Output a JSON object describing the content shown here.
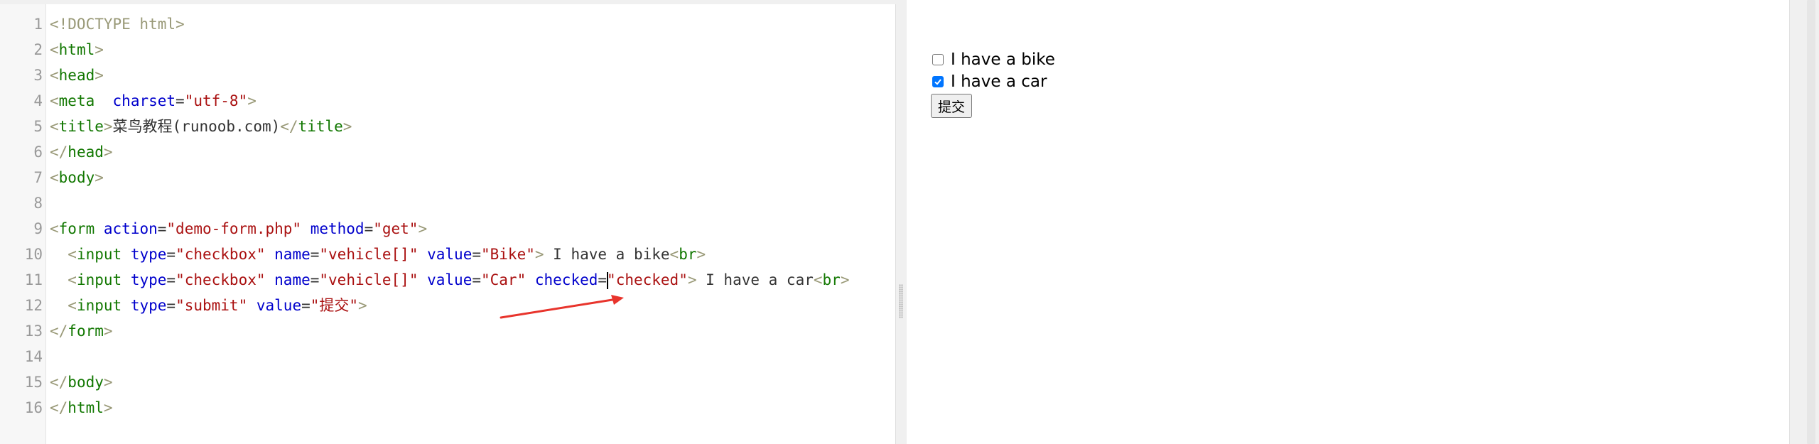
{
  "editor": {
    "line_numbers": [
      "1",
      "2",
      "3",
      "4",
      "5",
      "6",
      "7",
      "8",
      "9",
      "10",
      "11",
      "12",
      "13",
      "14",
      "15",
      "16"
    ],
    "lines": [
      [
        {
          "t": "tok-bracket",
          "v": "<!DOCTYPE html>"
        }
      ],
      [
        {
          "t": "tok-bracket",
          "v": "<"
        },
        {
          "t": "tok-tag",
          "v": "html"
        },
        {
          "t": "tok-bracket",
          "v": ">"
        }
      ],
      [
        {
          "t": "tok-bracket",
          "v": "<"
        },
        {
          "t": "tok-tag",
          "v": "head"
        },
        {
          "t": "tok-bracket",
          "v": ">"
        }
      ],
      [
        {
          "t": "tok-bracket",
          "v": "<"
        },
        {
          "t": "tok-tag",
          "v": "meta"
        },
        {
          "t": "tok-text",
          "v": "  "
        },
        {
          "t": "tok-attr",
          "v": "charset"
        },
        {
          "t": "tok-text",
          "v": "="
        },
        {
          "t": "tok-str",
          "v": "\"utf-8\""
        },
        {
          "t": "tok-bracket",
          "v": ">"
        }
      ],
      [
        {
          "t": "tok-bracket",
          "v": "<"
        },
        {
          "t": "tok-tag",
          "v": "title"
        },
        {
          "t": "tok-bracket",
          "v": ">"
        },
        {
          "t": "tok-text",
          "v": "菜鸟教程(runoob.com)"
        },
        {
          "t": "tok-bracket",
          "v": "</"
        },
        {
          "t": "tok-tag",
          "v": "title"
        },
        {
          "t": "tok-bracket",
          "v": ">"
        }
      ],
      [
        {
          "t": "tok-bracket",
          "v": "</"
        },
        {
          "t": "tok-tag",
          "v": "head"
        },
        {
          "t": "tok-bracket",
          "v": ">"
        }
      ],
      [
        {
          "t": "tok-bracket",
          "v": "<"
        },
        {
          "t": "tok-tag",
          "v": "body"
        },
        {
          "t": "tok-bracket",
          "v": ">"
        }
      ],
      [],
      [
        {
          "t": "tok-bracket",
          "v": "<"
        },
        {
          "t": "tok-tag",
          "v": "form"
        },
        {
          "t": "tok-text",
          "v": " "
        },
        {
          "t": "tok-attr",
          "v": "action"
        },
        {
          "t": "tok-text",
          "v": "="
        },
        {
          "t": "tok-str",
          "v": "\"demo-form.php\""
        },
        {
          "t": "tok-text",
          "v": " "
        },
        {
          "t": "tok-attr",
          "v": "method"
        },
        {
          "t": "tok-text",
          "v": "="
        },
        {
          "t": "tok-str",
          "v": "\"get\""
        },
        {
          "t": "tok-bracket",
          "v": ">"
        }
      ],
      [
        {
          "t": "tok-text",
          "v": "  "
        },
        {
          "t": "tok-bracket",
          "v": "<"
        },
        {
          "t": "tok-tag",
          "v": "input"
        },
        {
          "t": "tok-text",
          "v": " "
        },
        {
          "t": "tok-attr",
          "v": "type"
        },
        {
          "t": "tok-text",
          "v": "="
        },
        {
          "t": "tok-str",
          "v": "\"checkbox\""
        },
        {
          "t": "tok-text",
          "v": " "
        },
        {
          "t": "tok-attr",
          "v": "name"
        },
        {
          "t": "tok-text",
          "v": "="
        },
        {
          "t": "tok-str",
          "v": "\"vehicle[]\""
        },
        {
          "t": "tok-text",
          "v": " "
        },
        {
          "t": "tok-attr",
          "v": "value"
        },
        {
          "t": "tok-text",
          "v": "="
        },
        {
          "t": "tok-str",
          "v": "\"Bike\""
        },
        {
          "t": "tok-bracket",
          "v": ">"
        },
        {
          "t": "tok-text",
          "v": " I have a bike"
        },
        {
          "t": "tok-bracket",
          "v": "<"
        },
        {
          "t": "tok-tag",
          "v": "br"
        },
        {
          "t": "tok-bracket",
          "v": ">"
        }
      ],
      [
        {
          "t": "tok-text",
          "v": "  "
        },
        {
          "t": "tok-bracket",
          "v": "<"
        },
        {
          "t": "tok-tag",
          "v": "input"
        },
        {
          "t": "tok-text",
          "v": " "
        },
        {
          "t": "tok-attr",
          "v": "type"
        },
        {
          "t": "tok-text",
          "v": "="
        },
        {
          "t": "tok-str",
          "v": "\"checkbox\""
        },
        {
          "t": "tok-text",
          "v": " "
        },
        {
          "t": "tok-attr",
          "v": "name"
        },
        {
          "t": "tok-text",
          "v": "="
        },
        {
          "t": "tok-str",
          "v": "\"vehicle[]\""
        },
        {
          "t": "tok-text",
          "v": " "
        },
        {
          "t": "tok-attr",
          "v": "value"
        },
        {
          "t": "tok-text",
          "v": "="
        },
        {
          "t": "tok-str",
          "v": "\"Car\""
        },
        {
          "t": "tok-text",
          "v": " "
        },
        {
          "t": "tok-attr",
          "v": "checked"
        },
        {
          "t": "tok-text",
          "v": "="
        },
        {
          "t": "cursor",
          "v": ""
        },
        {
          "t": "tok-str",
          "v": "\"checked\""
        },
        {
          "t": "tok-bracket",
          "v": ">"
        },
        {
          "t": "tok-text",
          "v": " I have a car"
        },
        {
          "t": "tok-bracket",
          "v": "<"
        },
        {
          "t": "tok-tag",
          "v": "br"
        },
        {
          "t": "tok-bracket",
          "v": ">"
        }
      ],
      [
        {
          "t": "tok-text",
          "v": "  "
        },
        {
          "t": "tok-bracket",
          "v": "<"
        },
        {
          "t": "tok-tag",
          "v": "input"
        },
        {
          "t": "tok-text",
          "v": " "
        },
        {
          "t": "tok-attr",
          "v": "type"
        },
        {
          "t": "tok-text",
          "v": "="
        },
        {
          "t": "tok-str",
          "v": "\"submit\""
        },
        {
          "t": "tok-text",
          "v": " "
        },
        {
          "t": "tok-attr",
          "v": "value"
        },
        {
          "t": "tok-text",
          "v": "="
        },
        {
          "t": "tok-str",
          "v": "\"提交\""
        },
        {
          "t": "tok-bracket",
          "v": ">"
        }
      ],
      [
        {
          "t": "tok-bracket",
          "v": "</"
        },
        {
          "t": "tok-tag",
          "v": "form"
        },
        {
          "t": "tok-bracket",
          "v": ">"
        }
      ],
      [],
      [
        {
          "t": "tok-bracket",
          "v": "</"
        },
        {
          "t": "tok-tag",
          "v": "body"
        },
        {
          "t": "tok-bracket",
          "v": ">"
        }
      ],
      [
        {
          "t": "tok-bracket",
          "v": "</"
        },
        {
          "t": "tok-tag",
          "v": "html"
        },
        {
          "t": "tok-bracket",
          "v": ">"
        }
      ]
    ]
  },
  "preview": {
    "bike_label": "I have a bike",
    "bike_checked": false,
    "car_label": "I have a car",
    "car_checked": true,
    "submit_label": "提交"
  },
  "colors": {
    "tag": "#117700",
    "attr": "#0000cc",
    "string": "#aa1111",
    "bracket": "#999977",
    "annotation_arrow": "#e8342c",
    "checkbox_checked": "#0075ff"
  },
  "icons": {
    "annotation": "arrow-icon",
    "checkmark": "checkmark-icon"
  }
}
